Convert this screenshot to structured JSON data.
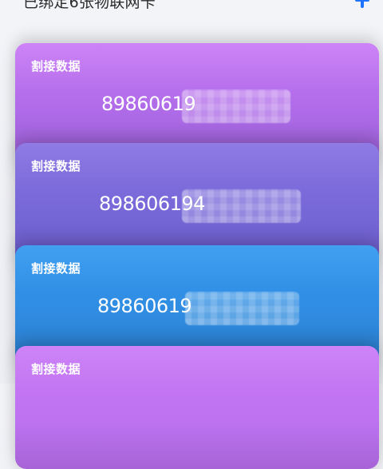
{
  "header": {
    "bound_text": "已绑定6张物联网卡"
  },
  "cards": [
    {
      "title": "割接数据",
      "number": "89860619",
      "color_top": "#c979f6",
      "color_bottom": "#9f63db"
    },
    {
      "title": "割接数据",
      "number": "898606194",
      "color_top": "#8670e1",
      "color_bottom": "#6f5fd0"
    },
    {
      "title": "割接数据",
      "number": "89860619",
      "color_top": "#3198ef",
      "color_bottom": "#2c7fd1"
    },
    {
      "title": "割接数据",
      "number": "",
      "color_top": "#c979f6",
      "color_bottom": "#b46ce9"
    }
  ]
}
